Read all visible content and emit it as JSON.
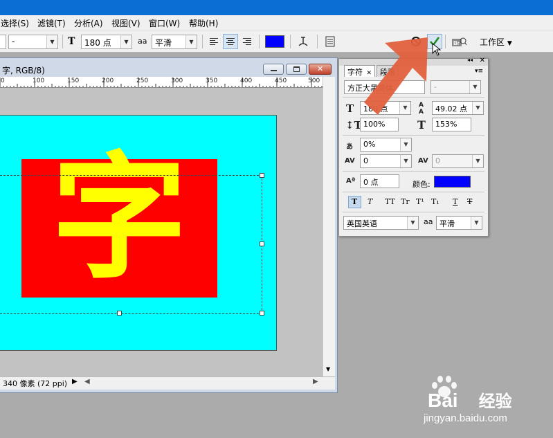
{
  "menubar": {
    "items": [
      "选择(S)",
      "滤镜(T)",
      "分析(A)",
      "视图(V)",
      "窗口(W)",
      "帮助(H)"
    ]
  },
  "options_bar": {
    "font_style_value": "-",
    "font_size_value": "180 点",
    "aa_label": "aa",
    "antialias_value": "平滑",
    "text_color": "#0000ff",
    "workspace_label": "工作区"
  },
  "document": {
    "title": "字, RGB/8)",
    "ruler_labels": [
      "0",
      "100",
      "150",
      "200",
      "250",
      "300",
      "350",
      "400",
      "450",
      "500"
    ],
    "status_text": "340 像素 (72 ppi)",
    "canvas_bg": "#00ffff",
    "box_color": "#ff0000",
    "glyph": "字",
    "glyph_color": "#ffff00"
  },
  "char_panel": {
    "tab_character": "字符",
    "tab_paragraph": "段落",
    "font_family": "方正大黑简体",
    "font_style": "-",
    "font_size": "180 点",
    "leading": "49.02 点",
    "vertical_scale": "100%",
    "horizontal_scale": "153%",
    "tsume": "0%",
    "kerning": "0",
    "tracking": "0",
    "baseline_shift": "0 点",
    "color_label": "颜色:",
    "color_value": "#0000ff",
    "language": "英国英语",
    "aa_label": "aa",
    "antialias": "平滑",
    "format_buttons": [
      "T",
      "T",
      "TT",
      "Tr",
      "T¹",
      "T₁",
      "T",
      "T"
    ]
  },
  "watermark": {
    "logo": "Bai",
    "logo_suffix": "经验",
    "url": "jingyan.baidu.com"
  }
}
